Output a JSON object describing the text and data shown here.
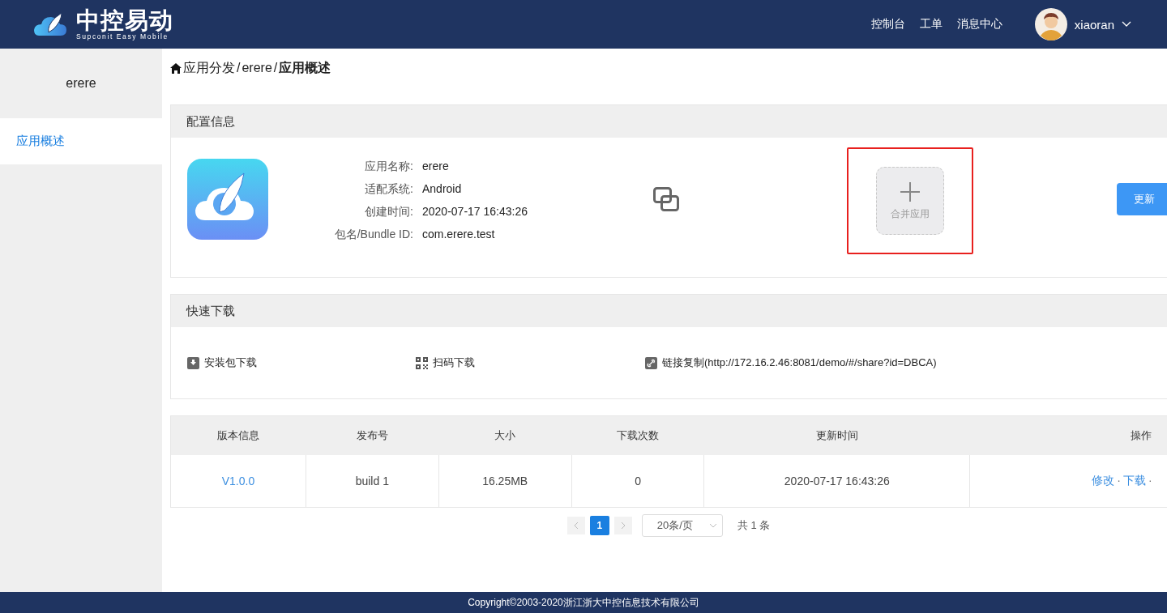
{
  "header": {
    "brand": "中控易动",
    "brand_sub": "Supconit Easy Mobile",
    "nav": [
      "控制台",
      "工单",
      "消息中心"
    ],
    "user": "xiaoran"
  },
  "sidebar": {
    "title": "erere",
    "items": [
      {
        "label": "应用概述",
        "selected": true
      }
    ]
  },
  "breadcrumb_separator": "/",
  "breadcrumb": [
    {
      "label": "应用分发",
      "current": false
    },
    {
      "label": "erere",
      "current": false
    },
    {
      "label": "应用概述",
      "current": true
    }
  ],
  "config": {
    "title": "配置信息",
    "fields": [
      {
        "label": "应用名称:",
        "value": "erere"
      },
      {
        "label": "适配系统:",
        "value": "Android"
      },
      {
        "label": "创建时间:",
        "value": "2020-07-17 16:43:26"
      },
      {
        "label": "包名/Bundle ID:",
        "value": "com.erere.test"
      }
    ],
    "merge_label": "合并应用",
    "update_button": "更新"
  },
  "quick": {
    "title": "快速下载",
    "links": [
      {
        "kind": "package",
        "label": "安装包下载"
      },
      {
        "kind": "qr",
        "label": "扫码下载"
      },
      {
        "kind": "link",
        "label": "链接复制(http://172.16.2.46:8081/demo/#/share?id=DBCA)"
      }
    ]
  },
  "table": {
    "columns": [
      "版本信息",
      "发布号",
      "大小",
      "下载次数",
      "更新时间",
      "操作"
    ],
    "rows": [
      {
        "version": "V1.0.0",
        "build": "build 1",
        "size": "16.25MB",
        "downloads": "0",
        "updated": "2020-07-17 16:43:26",
        "actions": [
          "修改",
          "·",
          "下载",
          "·"
        ]
      }
    ]
  },
  "pagination": {
    "pages": [
      {
        "label": "1",
        "selected": true
      }
    ],
    "page_size": "20条/页",
    "total": "共 1 条"
  },
  "footer": "Copyright©2003-2020浙江浙大中控信息技术有限公司"
}
